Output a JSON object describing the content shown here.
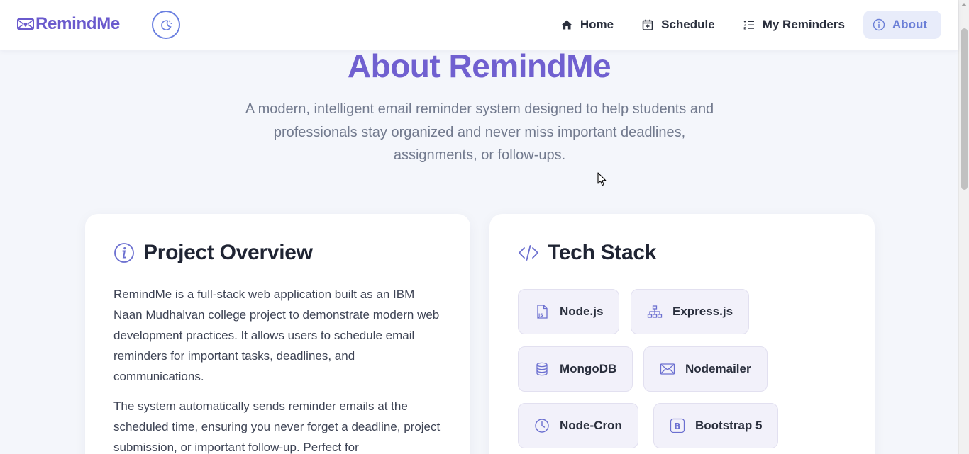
{
  "brand": {
    "name": "RemindMe",
    "accent": "#6a5acd"
  },
  "nav": {
    "items": [
      {
        "label": "Home",
        "icon": "home-icon",
        "active": false
      },
      {
        "label": "Schedule",
        "icon": "calendar-plus-icon",
        "active": false
      },
      {
        "label": "My Reminders",
        "icon": "list-icon",
        "active": false
      },
      {
        "label": "About",
        "icon": "info-icon",
        "active": true
      }
    ]
  },
  "hero": {
    "title": "About RemindMe",
    "subtitle": "A modern, intelligent email reminder system designed to help students and professionals stay organized and never miss important deadlines, assignments, or follow-ups."
  },
  "overview": {
    "title": "Project Overview",
    "p1": "RemindMe is a full-stack web application built as an IBM Naan Mudhalvan college project to demonstrate modern web development practices. It allows users to schedule email reminders for important tasks, deadlines, and communications.",
    "p2": "The system automatically sends reminder emails at the scheduled time, ensuring you never forget a deadline, project submission, or important follow-up. Perfect for"
  },
  "tech": {
    "title": "Tech Stack",
    "items": [
      {
        "label": "Node.js",
        "icon": "js-file-icon"
      },
      {
        "label": "Express.js",
        "icon": "sitemap-icon"
      },
      {
        "label": "MongoDB",
        "icon": "database-icon"
      },
      {
        "label": "Nodemailer",
        "icon": "envelope-icon"
      },
      {
        "label": "Node-Cron",
        "icon": "clock-icon"
      },
      {
        "label": "Bootstrap 5",
        "icon": "bootstrap-icon"
      }
    ]
  }
}
